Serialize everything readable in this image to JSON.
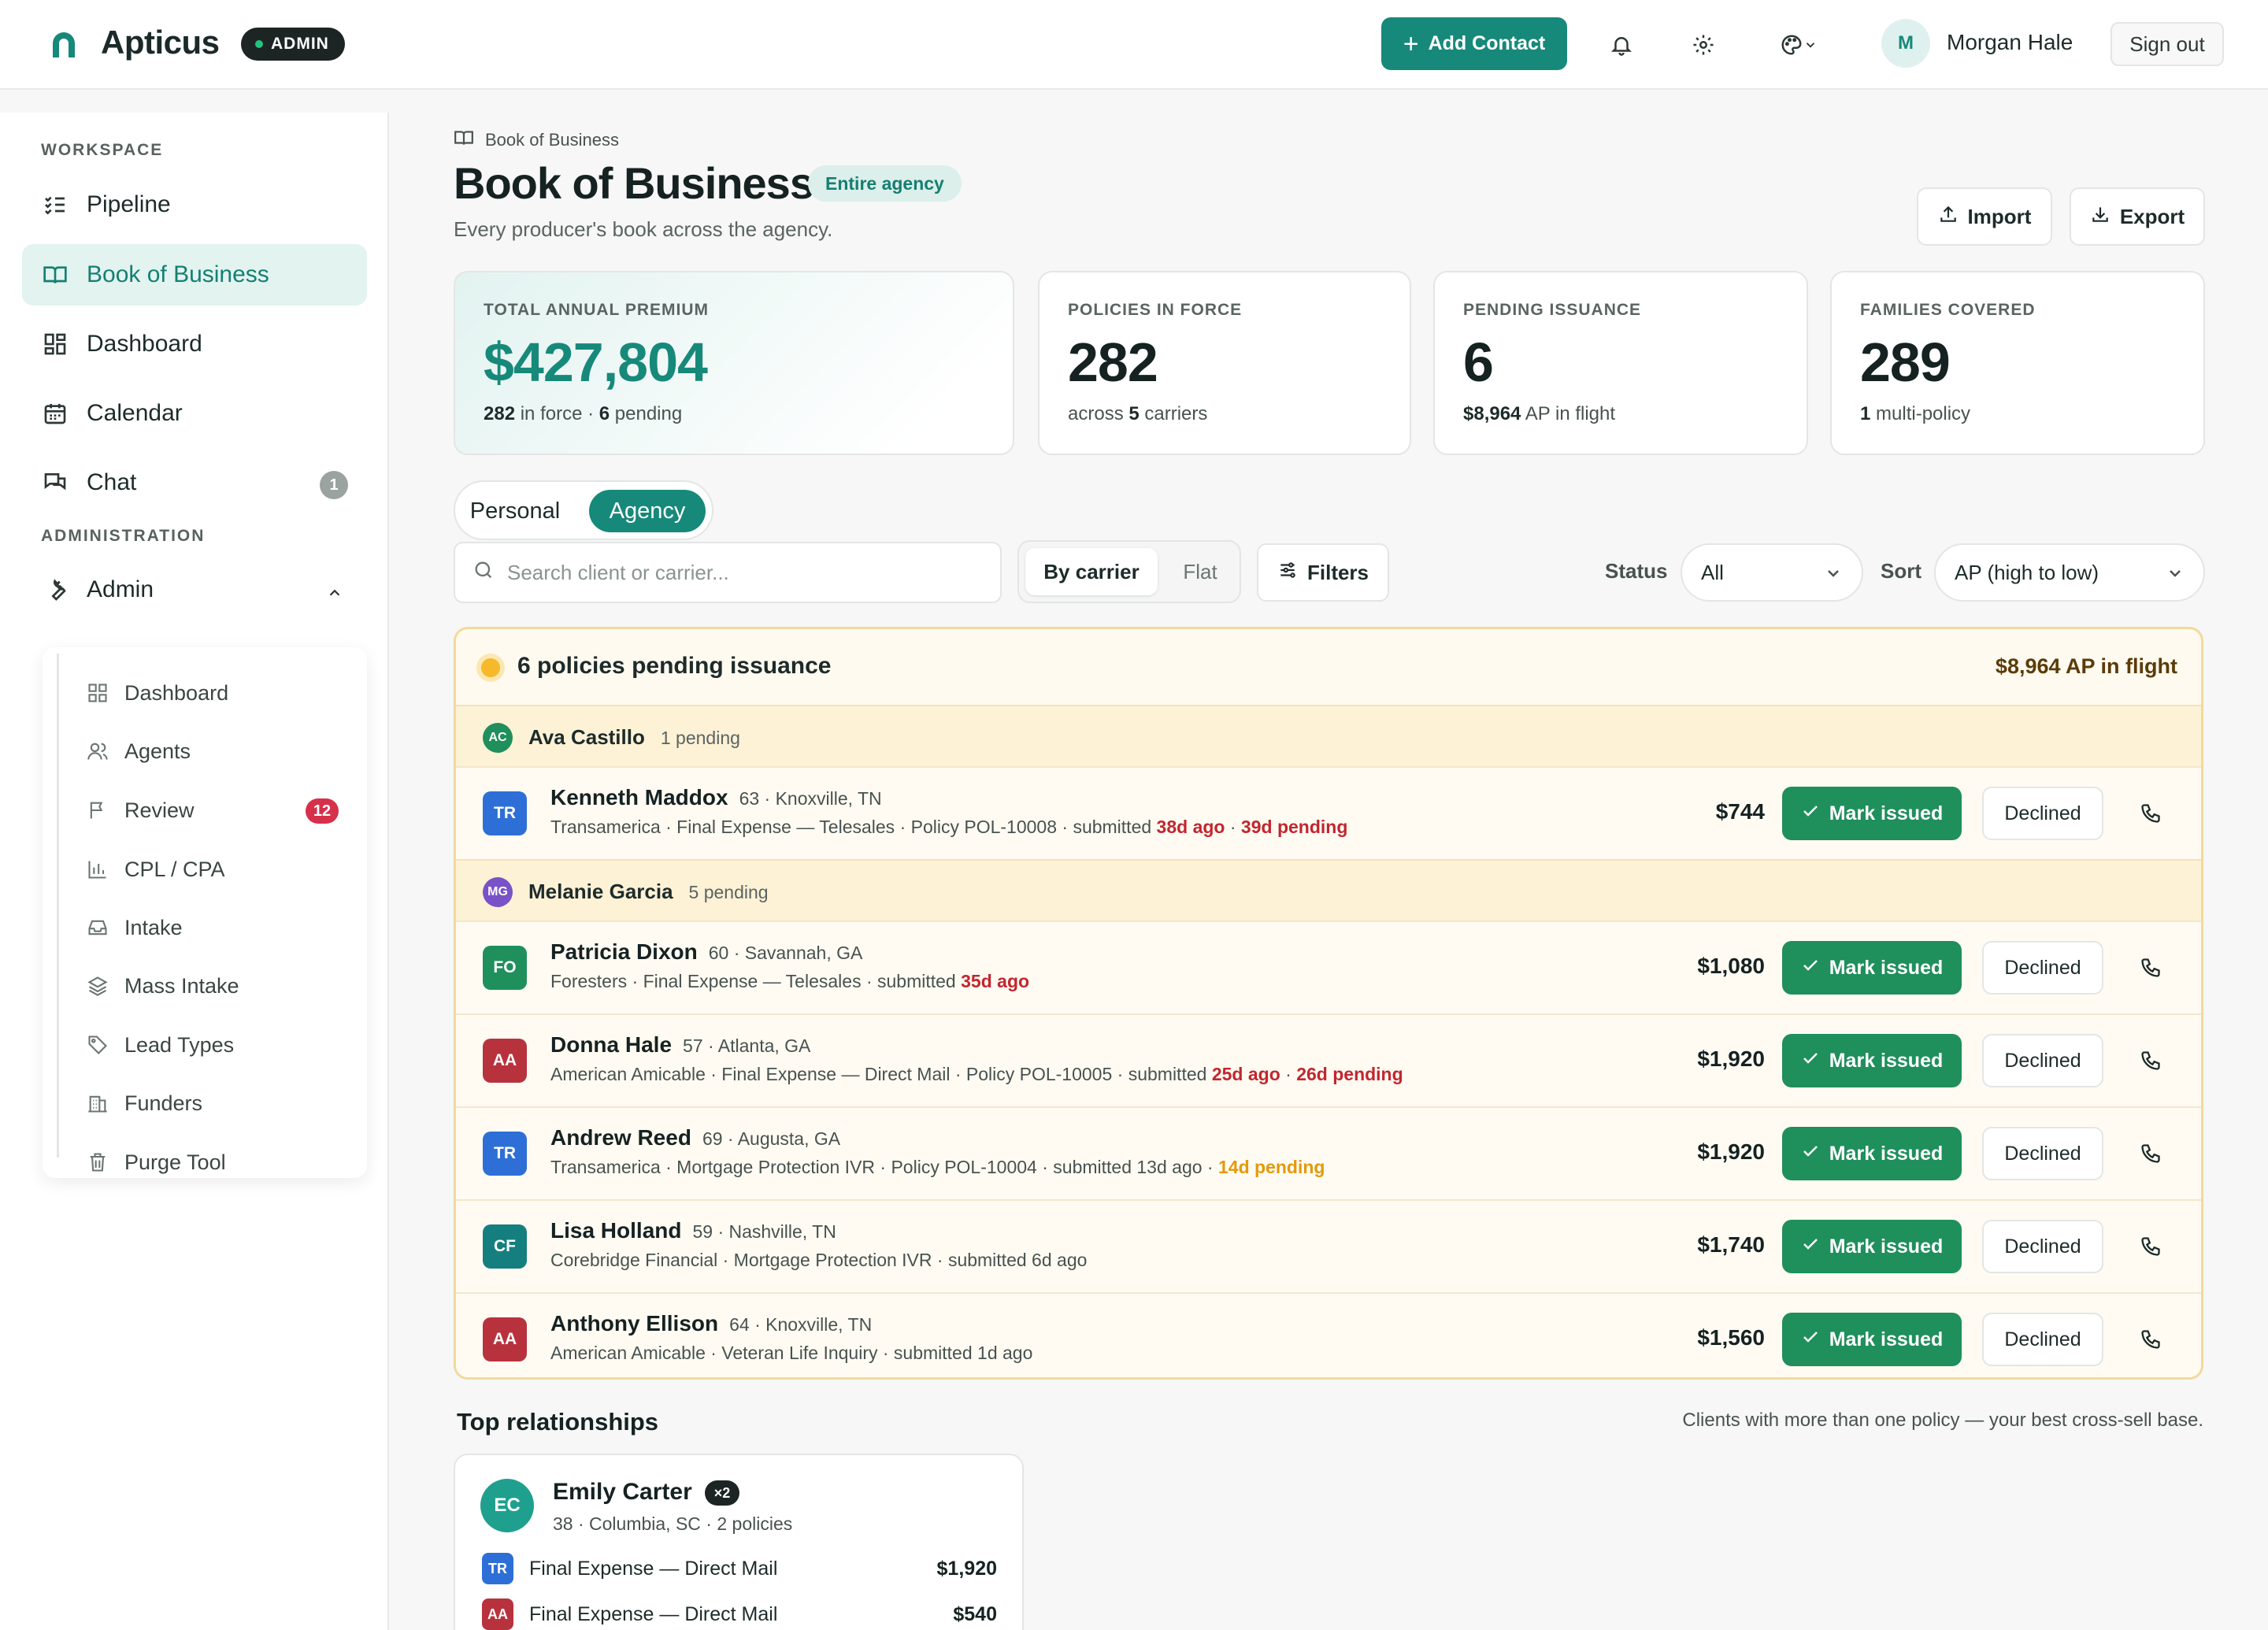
{
  "app": {
    "brand": "Apticus",
    "role_badge": "ADMIN"
  },
  "header": {
    "add_contact": "Add Contact",
    "user_initial": "M",
    "user_name": "Morgan Hale",
    "sign_out": "Sign out"
  },
  "sidebar": {
    "workspace_label": "WORKSPACE",
    "admin_label": "ADMINISTRATION",
    "items": [
      {
        "label": "Pipeline",
        "icon": "list-check-icon"
      },
      {
        "label": "Book of Business",
        "icon": "book-open-icon",
        "active": true
      },
      {
        "label": "Dashboard",
        "icon": "layout-grid-icon"
      },
      {
        "label": "Calendar",
        "icon": "calendar-icon"
      },
      {
        "label": "Chat",
        "icon": "chat-icon",
        "badge": "1"
      }
    ],
    "admin_item": {
      "label": "Admin",
      "icon": "wrench-icon"
    },
    "admin_sub": [
      {
        "label": "Dashboard",
        "icon": "layout-grid-icon"
      },
      {
        "label": "Agents",
        "icon": "users-icon"
      },
      {
        "label": "Review",
        "icon": "flag-icon",
        "badge": "12"
      },
      {
        "label": "CPL / CPA",
        "icon": "bar-chart-icon"
      },
      {
        "label": "Intake",
        "icon": "inbox-icon"
      },
      {
        "label": "Mass Intake",
        "icon": "layers-icon"
      },
      {
        "label": "Lead Types",
        "icon": "tag-icon"
      },
      {
        "label": "Funders",
        "icon": "building-icon"
      },
      {
        "label": "Purge Tool",
        "icon": "trash-icon"
      }
    ]
  },
  "page": {
    "breadcrumb": "Book of Business",
    "title": "Book of Business",
    "scope_pill": "Entire agency",
    "subtitle": "Every producer's book across the agency.",
    "import": "Import",
    "export": "Export"
  },
  "stats": [
    {
      "label": "TOTAL ANNUAL PREMIUM",
      "value": "$427,804",
      "sub_b1": "282",
      "sub_t1": " in force · ",
      "sub_b2": "6",
      "sub_t2": " pending"
    },
    {
      "label": "POLICIES IN FORCE",
      "value": "282",
      "sub_b1": "",
      "sub_t1": "across ",
      "sub_b2": "5",
      "sub_t2": " carriers"
    },
    {
      "label": "PENDING ISSUANCE",
      "value": "6",
      "sub_b1": "$8,964",
      "sub_t1": " AP in flight",
      "sub_b2": "",
      "sub_t2": ""
    },
    {
      "label": "FAMILIES COVERED",
      "value": "289",
      "sub_b1": "1",
      "sub_t1": " multi-policy",
      "sub_b2": "",
      "sub_t2": ""
    }
  ],
  "view_toggle": {
    "personal": "Personal",
    "agency": "Agency",
    "selected": "Agency"
  },
  "search": {
    "placeholder": "Search client or carrier..."
  },
  "grouping": {
    "by_carrier": "By carrier",
    "flat": "Flat",
    "selected": "By carrier"
  },
  "filters": {
    "label": "Filters"
  },
  "status_filter": {
    "label": "Status",
    "value": "All"
  },
  "sort": {
    "label": "Sort",
    "value": "AP (high to low)"
  },
  "pending": {
    "title": "6 policies pending issuance",
    "total": "$8,964 AP in flight",
    "mark_issued": "Mark issued",
    "declined": "Declined",
    "groups": [
      {
        "agent_initials": "AC",
        "agent": "Ava Castillo",
        "count": "1 pending",
        "color": "#1f8f5c"
      },
      {
        "agent_initials": "MG",
        "agent": "Melanie Garcia",
        "count": "5 pending",
        "color": "#7a52c7"
      }
    ],
    "rows": [
      {
        "carrier": "TR",
        "carrier_color": "#2d6fd6",
        "name": "Kenneth Maddox",
        "meta": "63 · Knoxville, TN",
        "desc": "Transamerica · Final Expense — Telesales · Policy POL-10008 · submitted ",
        "age": "38d ago",
        "pend_sep": " · ",
        "pend": "39d pending",
        "amount": "$744"
      },
      {
        "carrier": "FO",
        "carrier_color": "#1f8f5c",
        "name": "Patricia Dixon",
        "meta": "60 · Savannah, GA",
        "desc": "Foresters · Final Expense — Telesales · submitted ",
        "age": "35d ago",
        "pend_sep": "",
        "pend": "",
        "amount": "$1,080"
      },
      {
        "carrier": "AA",
        "carrier_color": "#b8323d",
        "name": "Donna Hale",
        "meta": "57 · Atlanta, GA",
        "desc": "American Amicable · Final Expense — Direct Mail · Policy POL-10005 · submitted ",
        "age": "25d ago",
        "pend_sep": " · ",
        "pend": "26d pending",
        "amount": "$1,920"
      },
      {
        "carrier": "TR",
        "carrier_color": "#2d6fd6",
        "name": "Andrew Reed",
        "meta": "69 · Augusta, GA",
        "desc": "Transamerica · Mortgage Protection IVR · Policy POL-10004 · submitted 13d ago",
        "age": "",
        "pend_sep": " · ",
        "pend": "14d pending",
        "amount": "$1,920"
      },
      {
        "carrier": "CF",
        "carrier_color": "#157f80",
        "name": "Lisa Holland",
        "meta": "59 · Nashville, TN",
        "desc": "Corebridge Financial · Mortgage Protection IVR · submitted 6d ago",
        "age": "",
        "pend_sep": "",
        "pend": "",
        "amount": "$1,740"
      },
      {
        "carrier": "AA",
        "carrier_color": "#b8323d",
        "name": "Anthony Ellison",
        "meta": "64 · Knoxville, TN",
        "desc": "American Amicable · Veteran Life Inquiry · submitted 1d ago",
        "age": "",
        "pend_sep": "",
        "pend": "",
        "amount": "$1,560"
      }
    ]
  },
  "relationships": {
    "title": "Top relationships",
    "note": "Clients with more than one policy — your best cross-sell base.",
    "cards": [
      {
        "initials": "EC",
        "name": "Emily Carter",
        "multiplier": "×2",
        "meta": "38 · Columbia, SC · 2 policies",
        "policies": [
          {
            "carrier": "TR",
            "carrier_color": "#2d6fd6",
            "product": "Final Expense — Direct Mail",
            "amount": "$1,920"
          },
          {
            "carrier": "AA",
            "carrier_color": "#b8323d",
            "product": "Final Expense — Direct Mail",
            "amount": "$540"
          }
        ]
      }
    ]
  },
  "colors": {
    "accent": "#17897a",
    "success": "#1f8f5c",
    "warning": "#f5b92a",
    "danger": "#c2262e"
  }
}
